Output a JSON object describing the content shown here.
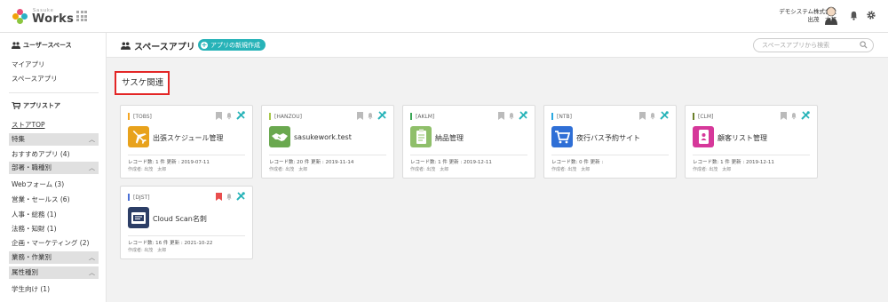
{
  "header": {
    "logo_small": "Sasuke",
    "logo_text": "Works",
    "company": "デモシステム株式会社",
    "user_name": "出茂　太郎"
  },
  "sidebar": {
    "user_space_heading": "ユーザースペース",
    "my_app": "マイアプリ",
    "space_app": "スペースアプリ",
    "app_store_heading": "アプリストア",
    "store_top": "ストアTOP",
    "sections": [
      {
        "label": "特集",
        "items": [
          "おすすめアプリ (4)"
        ]
      },
      {
        "label": "部署・職種別",
        "items": [
          "Webフォーム (3)",
          "営業・セールス (6)",
          "人事・総務 (1)",
          "法務・知財 (1)",
          "企画・マーケティング (2)"
        ]
      },
      {
        "label": "業務・作業別",
        "items": []
      },
      {
        "label": "属性種別",
        "items": [
          "学生向け (1)"
        ]
      }
    ]
  },
  "main": {
    "title": "スペースアプリ",
    "new_app_label": "アプリの新規作成",
    "search_placeholder": "スペースアプリから検索",
    "category": "サスケ関連",
    "cards": [
      {
        "code": "[TOBS]",
        "name": "出張スケジュール管理",
        "meta": "レコード数: 1 件   更新 : 2019-07-11",
        "creator": "作成者: 出茂　太郎",
        "color": "#f5a623",
        "icon": "airplane-icon",
        "icon_bg": "#e8a21c",
        "bookmarked": false
      },
      {
        "code": "[HANZOU]",
        "name": "sasukework.test",
        "meta": "レコード数: 20 件   更新 : 2019-11-14",
        "creator": "作成者: 出茂　太郎",
        "color": "#a8c84a",
        "icon": "handshake-icon",
        "icon_bg": "#6aa84f",
        "bookmarked": false
      },
      {
        "code": "[AKLM]",
        "name": "納品管理",
        "meta": "レコード数: 1 件   更新 : 2019-12-11",
        "creator": "作成者: 出茂　太郎",
        "color": "#3aa655",
        "icon": "clipboard-icon",
        "icon_bg": "#8fbf6a",
        "bookmarked": false
      },
      {
        "code": "[NTB]",
        "name": "夜行バス予約サイト",
        "meta": "レコード数: 0 件   更新 :",
        "creator": "作成者: 出茂　太郎",
        "color": "#2aa8e0",
        "icon": "cart-icon",
        "icon_bg": "#2f6fd6",
        "bookmarked": false
      },
      {
        "code": "[CLM]",
        "name": "顧客リスト管理",
        "meta": "レコード数: 1 件   更新 : 2019-12-11",
        "creator": "作成者: 出茂　太郎",
        "color": "#6b7f2a",
        "icon": "id-badge-icon",
        "icon_bg": "#d6389a",
        "bookmarked": false
      },
      {
        "code": "[DJST]",
        "name": "Cloud Scan名刺",
        "meta": "レコード数: 16 件   更新 : 2021-10-22",
        "creator": "作成者: 出茂　太郎",
        "color": "#4a6fd6",
        "icon": "card-scanner-icon",
        "icon_bg": "#2c3e66",
        "bookmarked": true
      }
    ]
  }
}
